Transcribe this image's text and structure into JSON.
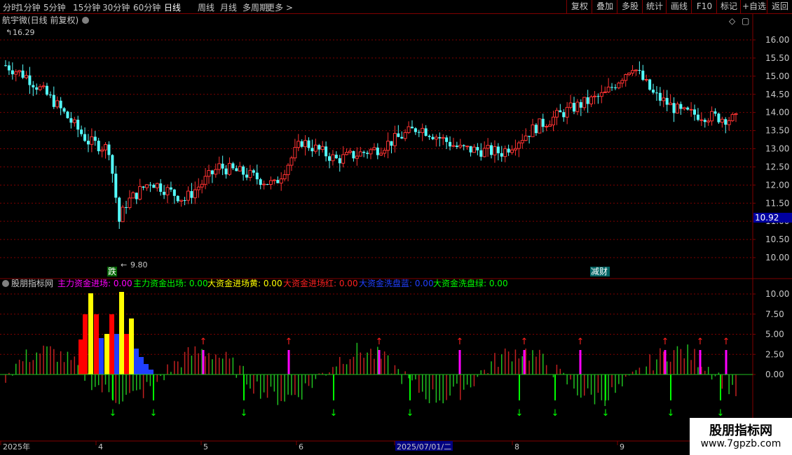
{
  "toolbar": {
    "left_items": [
      "分时",
      "1分钟",
      "5分钟",
      "15分钟",
      "30分钟",
      "60分钟",
      "日线",
      "周线",
      "月线",
      "多周期",
      "更多 >"
    ],
    "active": "日线",
    "right_items": [
      "复权",
      "叠加",
      "多股",
      "统计",
      "画线",
      "F10",
      "标记",
      "+自选",
      "返回"
    ]
  },
  "main": {
    "title": "航宇微(日线 前复权)",
    "high_label": "16.29",
    "low_label": "9.80",
    "current_price": "10.92",
    "badge_die": "跌",
    "badge_jiancai": "减财",
    "y_ticks": [
      "16.00",
      "15.50",
      "15.00",
      "14.50",
      "14.00",
      "13.50",
      "13.00",
      "12.50",
      "12.00",
      "11.50",
      "11.00",
      "10.50",
      "10.00"
    ]
  },
  "indicator": {
    "name": "股朋指标网",
    "legend": [
      {
        "label": "主力资金进场: 0.00",
        "color": "#ff00ff"
      },
      {
        "label": "主力资金出场: 0.00",
        "color": "#00ff00"
      },
      {
        "label": "大资金进场黄: 0.00",
        "color": "#ffff00"
      },
      {
        "label": "大资金进场红: 0.00",
        "color": "#ff2020"
      },
      {
        "label": "大资金洗盘蓝: 0.00",
        "color": "#2040ff"
      },
      {
        "label": "大资金洗盘绿: 0.00",
        "color": "#00ff00"
      }
    ],
    "y_ticks": [
      "10.00",
      "7.50",
      "5.00",
      "2.50",
      "0.00"
    ]
  },
  "date_axis": {
    "labels": [
      "2025年",
      "4",
      "5",
      "6",
      "2025/07/01/二",
      "8",
      "9"
    ]
  },
  "watermark": {
    "line1": "股朋指标网",
    "line2": "www.7gpzb.com"
  },
  "colors": {
    "up": "#ff3232",
    "down": "#54ffff",
    "grid": "#800000",
    "axis": "#800000"
  }
}
